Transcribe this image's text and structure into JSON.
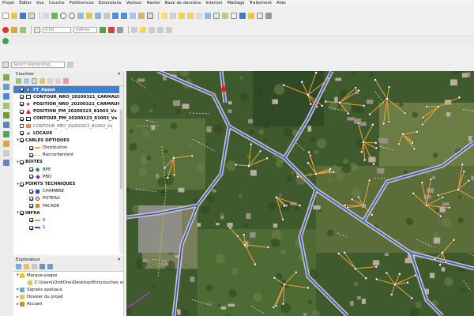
{
  "menubar": [
    "Projet",
    "Éditer",
    "Vue",
    "Couche",
    "Préférences",
    "Extensions",
    "Vecteur",
    "Raster",
    "Base de données",
    "Internet",
    "Maillage",
    "Traitement",
    "Aide"
  ],
  "digitizing": {
    "value": "0.00",
    "unit": "mètres"
  },
  "relationship": {
    "placeholder": "Select relationship..."
  },
  "layers_panel": {
    "title": "Couches",
    "items": [
      {
        "label": "FT_Appui",
        "selected": true,
        "checked": true,
        "bold": true,
        "indent": 0,
        "expand": "",
        "symbol": "point-yellow"
      },
      {
        "label": "CONTOUR_NRO_20200321_CARMAUX_V",
        "checked": true,
        "bold": true,
        "indent": 0,
        "expand": "",
        "symbol": "poly-none"
      },
      {
        "label": "POSITION_NRO_20200321_CARMAUX_V",
        "checked": true,
        "bold": true,
        "indent": 0,
        "expand": "",
        "symbol": "star-red"
      },
      {
        "label": "POSITION_PM_20200323_81003_Vx",
        "checked": true,
        "bold": true,
        "indent": 0,
        "expand": "",
        "symbol": "triangle-red"
      },
      {
        "label": "CONTOUR_PM_20200323_81003_Vx",
        "checked": true,
        "bold": true,
        "indent": 0,
        "expand": "",
        "symbol": "poly-none"
      },
      {
        "label": "CONTOUR_PBO_20200323_81003_Vx",
        "checked": false,
        "italic": true,
        "indent": 0,
        "expand": "",
        "symbol": "poly-orange"
      },
      {
        "label": "LOCAUX",
        "checked": true,
        "bold": true,
        "indent": 0,
        "expand": "",
        "symbol": "point-gray"
      },
      {
        "label": "CABLES OPTIQUES",
        "checked": true,
        "bold": true,
        "indent": 0,
        "expand": "▾",
        "symbol": ""
      },
      {
        "label": "Distribution",
        "checked": true,
        "indent": 2,
        "expand": "",
        "symbol": "line-orange"
      },
      {
        "label": "Raccordement",
        "checked": true,
        "indent": 2,
        "expand": "",
        "symbol": "line-dash-orange"
      },
      {
        "label": "BOITES",
        "checked": true,
        "bold": true,
        "indent": 0,
        "expand": "▾",
        "symbol": ""
      },
      {
        "label": "BPE",
        "checked": true,
        "indent": 2,
        "expand": "",
        "symbol": "pentagon-green"
      },
      {
        "label": "PBO",
        "checked": true,
        "indent": 2,
        "expand": "",
        "symbol": "diamond-purple"
      },
      {
        "label": "POINTS TECHNIQUES",
        "checked": true,
        "bold": true,
        "indent": 0,
        "expand": "▾",
        "symbol": ""
      },
      {
        "label": "CHAMBRE",
        "checked": true,
        "indent": 2,
        "expand": "",
        "symbol": "square-blue"
      },
      {
        "label": "POTEAU",
        "checked": true,
        "indent": 2,
        "expand": "",
        "symbol": "circle-white"
      },
      {
        "label": "FACADE",
        "checked": true,
        "indent": 2,
        "expand": "",
        "symbol": "square-orange"
      },
      {
        "label": "INFRA",
        "checked": true,
        "bold": true,
        "indent": 0,
        "expand": "▾",
        "symbol": ""
      },
      {
        "label": "0",
        "checked": true,
        "indent": 2,
        "expand": "",
        "symbol": "line-orange"
      },
      {
        "label": "1",
        "checked": true,
        "indent": 2,
        "expand": "",
        "symbol": "line-blue"
      }
    ]
  },
  "explorer": {
    "title": "Explorateur",
    "items": [
      {
        "label": "Marque-pages",
        "expand": "▾",
        "indent": 0,
        "icon": "star-icon"
      },
      {
        "label": "C:\\Users\\OrdiOne\\Desktop\\fttn\\couches ve",
        "expand": "",
        "indent": 2,
        "icon": "folder-icon"
      },
      {
        "label": "Signets spatiaux",
        "expand": "▸",
        "indent": 0,
        "icon": "bookmark-icon"
      },
      {
        "label": "Dossier du projet",
        "expand": "▸",
        "indent": 0,
        "icon": "folder-icon"
      },
      {
        "label": "Accueil",
        "expand": "▸",
        "indent": 0,
        "icon": "home-icon"
      }
    ]
  },
  "colors": {
    "selection": "#3d7fd9",
    "cable_orange": "#f0a43a",
    "infra_blue": "#2f4fd8",
    "marker_red": "#e32020"
  }
}
